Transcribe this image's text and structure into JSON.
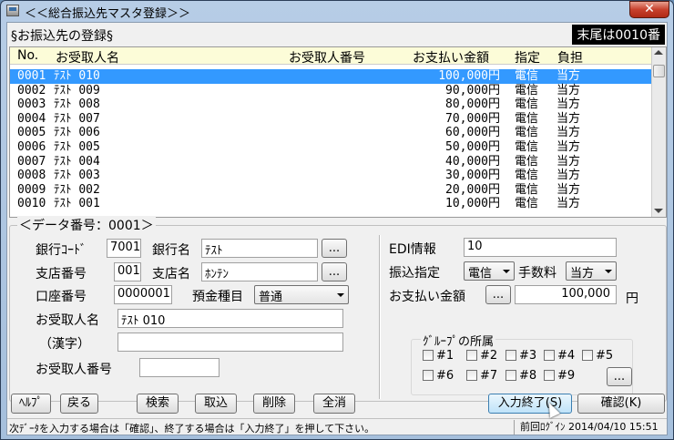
{
  "window": {
    "title": "＜＜総合振込先マスタ登録＞＞",
    "close_label": "✕"
  },
  "header": {
    "section_title": "§お振込先の登録§",
    "record_count": "末尾は0010番"
  },
  "list": {
    "columns": {
      "no": "No.",
      "name": "お受取人名",
      "recipient_no": "お受取人番号",
      "amount": "お支払い金額",
      "spec": "指定",
      "burden": "負担"
    },
    "rows": [
      {
        "no": "0001",
        "name": "ﾃｽﾄ 010",
        "amount": "100,000円",
        "spec": "電信",
        "burden": "当方"
      },
      {
        "no": "0002",
        "name": "ﾃｽﾄ 009",
        "amount": "90,000円",
        "spec": "電信",
        "burden": "当方"
      },
      {
        "no": "0003",
        "name": "ﾃｽﾄ 008",
        "amount": "80,000円",
        "spec": "電信",
        "burden": "当方"
      },
      {
        "no": "0004",
        "name": "ﾃｽﾄ 007",
        "amount": "70,000円",
        "spec": "電信",
        "burden": "当方"
      },
      {
        "no": "0005",
        "name": "ﾃｽﾄ 006",
        "amount": "60,000円",
        "spec": "電信",
        "burden": "当方"
      },
      {
        "no": "0006",
        "name": "ﾃｽﾄ 005",
        "amount": "50,000円",
        "spec": "電信",
        "burden": "当方"
      },
      {
        "no": "0007",
        "name": "ﾃｽﾄ 004",
        "amount": "40,000円",
        "spec": "電信",
        "burden": "当方"
      },
      {
        "no": "0008",
        "name": "ﾃｽﾄ 003",
        "amount": "30,000円",
        "spec": "電信",
        "burden": "当方"
      },
      {
        "no": "0009",
        "name": "ﾃｽﾄ 002",
        "amount": "20,000円",
        "spec": "電信",
        "burden": "当方"
      },
      {
        "no": "0010",
        "name": "ﾃｽﾄ 001",
        "amount": "10,000円",
        "spec": "電信",
        "burden": "当方"
      }
    ]
  },
  "form": {
    "group_title": "＜データ番号：0001＞",
    "bank_code_label": "銀行ｺｰﾄﾞ",
    "bank_code": "7001",
    "bank_name_label": "銀行名",
    "bank_name": "ﾃｽﾄ",
    "branch_no_label": "支店番号",
    "branch_no": "001",
    "branch_name_label": "支店名",
    "branch_name": "ﾎﾝﾃﾝ",
    "account_no_label": "口座番号",
    "account_no": "0000001",
    "deposit_type_label": "預金種目",
    "deposit_type": "普通",
    "recipient_name_label": "お受取人名",
    "recipient_name": "ﾃｽﾄ 010",
    "kanji_label": "（漢字）",
    "kanji_value": "",
    "recipient_no_label": "お受取人番号",
    "recipient_no": "",
    "edi_label": "EDI情報",
    "edi_value": "10",
    "transfer_spec_label": "振込指定",
    "transfer_spec": "電信",
    "fee_label": "手数料",
    "fee": "当方",
    "amount_label": "お支払い金額",
    "amount": "100,000",
    "yen": "円",
    "ellipsis": "...",
    "group_membership_label": "ｸﾞﾙｰﾌﾟの所属",
    "groups": [
      "#1",
      "#2",
      "#3",
      "#4",
      "#5",
      "#6",
      "#7",
      "#8",
      "#9"
    ]
  },
  "buttons": {
    "help": "ﾍﾙﾌﾟ",
    "back": "戻る",
    "search": "検索",
    "import": "取込",
    "delete": "削除",
    "clear_all": "全消",
    "finish_input": "入力終了(S)",
    "confirm": "確認(K)"
  },
  "status": {
    "message": "次ﾃﾞｰﾀを入力する場合は「確認」、終了する場合は「入力終了」を押して下さい。",
    "last_login": "前回ﾛｸﾞｲﾝ 2014/04/10 15:51"
  }
}
